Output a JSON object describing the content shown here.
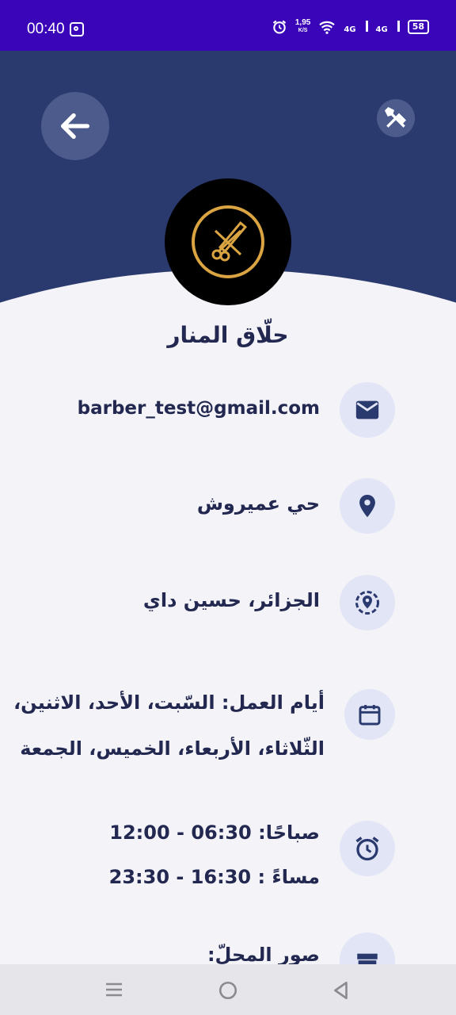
{
  "status_bar": {
    "time": "00:40",
    "speed_value": "1,95",
    "speed_unit": "K/S",
    "net1": "4G",
    "net2": "4G",
    "battery": "58"
  },
  "shop": {
    "name": "حلّاق المنار"
  },
  "contact": {
    "email": "barber_test@gmail.com",
    "address": "حي عميروش",
    "location": "الجزائر، حسين داي"
  },
  "work_days": {
    "line1": "أيام العمل: السّبت، الأحد، الاثنين،",
    "line2": "الثّلاثاء، الأربعاء، الخميس، الجمعة"
  },
  "hours": {
    "morning": "صباحًا: 06:30 - 12:00",
    "evening": "مساءً : 16:30 - 23:30"
  },
  "photos": {
    "label": "صور المحلّ:"
  },
  "icons": [
    "back-arrow-icon",
    "tools-icon",
    "scissors-comb-logo",
    "email-icon",
    "location-pin-icon",
    "location-target-icon",
    "calendar-icon",
    "alarm-clock-icon",
    "store-icon"
  ],
  "colors": {
    "status_bar": "#3a04b8",
    "header": "#2b3a6e",
    "text": "#222850",
    "icon_bg": "#e2e5f6"
  }
}
